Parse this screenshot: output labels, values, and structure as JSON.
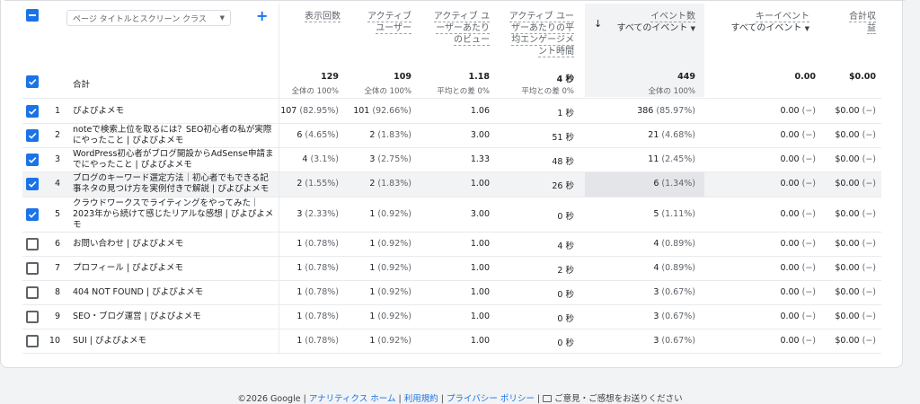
{
  "dimension": {
    "label": "ページ タイトルとスクリーン クラス",
    "caret": "▼",
    "add": "+"
  },
  "headers": {
    "views": "表示回数",
    "active_users_1": "アクティブ",
    "active_users_2": "ユーザー",
    "views_per_user_1": "アクティブ ユ",
    "views_per_user_2": "ーザーあたり",
    "views_per_user_3": "のビュー",
    "avg_time_1": "アクティブ ユー",
    "avg_time_2": "ザーあたりの平",
    "avg_time_3": "均エンゲージメ",
    "avg_time_4": "ント時間",
    "events": "イベント数",
    "events_sub": "すべてのイベント",
    "key_events": "キーイベント",
    "key_events_sub": "すべてのイベント",
    "revenue_1": "合計収",
    "revenue_2": "益",
    "sort_arrow": "↓",
    "caret": "▼"
  },
  "totals": {
    "label": "合計",
    "views": "129",
    "views_sub": "全体の 100%",
    "users": "109",
    "users_sub": "全体の 100%",
    "vpu": "1.18",
    "vpu_sub": "平均との差 0%",
    "time": "4 秒",
    "time_sub": "平均との差 0%",
    "events": "449",
    "events_sub": "全体の 100%",
    "key": "0.00",
    "revenue": "$0.00"
  },
  "rows": [
    {
      "idx": "1",
      "title": [
        "ぴよぴよメモ"
      ],
      "views": "107",
      "views_pct": "(82.95%)",
      "users": "101",
      "users_pct": "(92.66%)",
      "vpu": "1.06",
      "time": "1 秒",
      "events": "386",
      "events_pct": "(85.97%)",
      "key": "0.00",
      "key_pct": "(−)",
      "rev": "$0.00",
      "rev_pct": "(−)",
      "checked": true
    },
    {
      "idx": "2",
      "title": [
        "noteで検索上位を取るには？SEO初心者の私が実際",
        "にやったこと | ぴよぴよメモ"
      ],
      "views": "6",
      "views_pct": "(4.65%)",
      "users": "2",
      "users_pct": "(1.83%)",
      "vpu": "3.00",
      "time": "51 秒",
      "events": "21",
      "events_pct": "(4.68%)",
      "key": "0.00",
      "key_pct": "(−)",
      "rev": "$0.00",
      "rev_pct": "(−)",
      "checked": true
    },
    {
      "idx": "3",
      "title": [
        "WordPress初心者がブログ開設からAdSense申請ま",
        "でにやったこと | ぴよぴよメモ"
      ],
      "views": "4",
      "views_pct": "(3.1%)",
      "users": "3",
      "users_pct": "(2.75%)",
      "vpu": "1.33",
      "time": "48 秒",
      "events": "11",
      "events_pct": "(2.45%)",
      "key": "0.00",
      "key_pct": "(−)",
      "rev": "$0.00",
      "rev_pct": "(−)",
      "checked": true
    },
    {
      "idx": "4",
      "title": [
        "ブログのキーワード選定方法｜初心者でもできる記",
        "事ネタの見つけ方を実例付きで解説 | ぴよぴよメモ"
      ],
      "views": "2",
      "views_pct": "(1.55%)",
      "users": "2",
      "users_pct": "(1.83%)",
      "vpu": "1.00",
      "time": "26 秒",
      "events": "6",
      "events_pct": "(1.34%)",
      "key": "0.00",
      "key_pct": "(−)",
      "rev": "$0.00",
      "rev_pct": "(−)",
      "checked": true
    },
    {
      "idx": "5",
      "title": [
        "クラウドワークスでライティングをやってみた｜",
        "2023年から続けて感じたリアルな感想 | ぴよぴよメ",
        "モ"
      ],
      "views": "3",
      "views_pct": "(2.33%)",
      "users": "1",
      "users_pct": "(0.92%)",
      "vpu": "3.00",
      "time": "0 秒",
      "events": "5",
      "events_pct": "(1.11%)",
      "key": "0.00",
      "key_pct": "(−)",
      "rev": "$0.00",
      "rev_pct": "(−)",
      "checked": true
    },
    {
      "idx": "6",
      "title": [
        "お問い合わせ | ぴよぴよメモ"
      ],
      "views": "1",
      "views_pct": "(0.78%)",
      "users": "1",
      "users_pct": "(0.92%)",
      "vpu": "1.00",
      "time": "4 秒",
      "events": "4",
      "events_pct": "(0.89%)",
      "key": "0.00",
      "key_pct": "(−)",
      "rev": "$0.00",
      "rev_pct": "(−)",
      "checked": false
    },
    {
      "idx": "7",
      "title": [
        "プロフィール | ぴよぴよメモ"
      ],
      "views": "1",
      "views_pct": "(0.78%)",
      "users": "1",
      "users_pct": "(0.92%)",
      "vpu": "1.00",
      "time": "2 秒",
      "events": "4",
      "events_pct": "(0.89%)",
      "key": "0.00",
      "key_pct": "(−)",
      "rev": "$0.00",
      "rev_pct": "(−)",
      "checked": false
    },
    {
      "idx": "8",
      "title": [
        "404 NOT FOUND | ぴよぴよメモ"
      ],
      "views": "1",
      "views_pct": "(0.78%)",
      "users": "1",
      "users_pct": "(0.92%)",
      "vpu": "1.00",
      "time": "0 秒",
      "events": "3",
      "events_pct": "(0.67%)",
      "key": "0.00",
      "key_pct": "(−)",
      "rev": "$0.00",
      "rev_pct": "(−)",
      "checked": false
    },
    {
      "idx": "9",
      "title": [
        "SEO・ブログ運営 | ぴよぴよメモ"
      ],
      "views": "1",
      "views_pct": "(0.78%)",
      "users": "1",
      "users_pct": "(0.92%)",
      "vpu": "1.00",
      "time": "0 秒",
      "events": "3",
      "events_pct": "(0.67%)",
      "key": "0.00",
      "key_pct": "(−)",
      "rev": "$0.00",
      "rev_pct": "(−)",
      "checked": false
    },
    {
      "idx": "10",
      "title": [
        "SUI | ぴよぴよメモ"
      ],
      "views": "1",
      "views_pct": "(0.78%)",
      "users": "1",
      "users_pct": "(0.92%)",
      "vpu": "1.00",
      "time": "0 秒",
      "events": "3",
      "events_pct": "(0.67%)",
      "key": "0.00",
      "key_pct": "(−)",
      "rev": "$0.00",
      "rev_pct": "(−)",
      "checked": false
    }
  ],
  "footer": {
    "copyright": "©2026 Google",
    "sep": " | ",
    "home": "アナリティクス ホーム",
    "terms": "利用規約",
    "privacy": "プライバシー ポリシー",
    "feedback": "ご意見・ご感想をお送りください"
  },
  "colors": {
    "accent": "#1a73e8",
    "highlight": "#e8eaed",
    "sorted_col": "#f1f3f4"
  }
}
